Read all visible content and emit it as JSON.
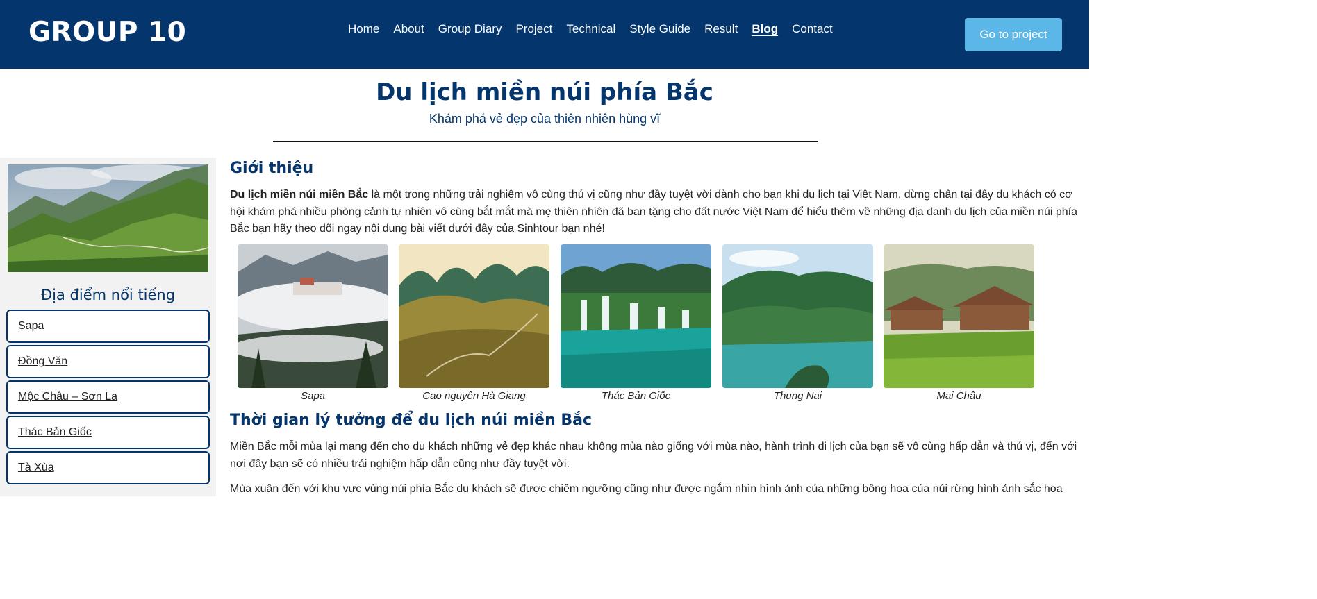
{
  "header": {
    "logo": "GROUP 10",
    "nav": [
      "Home",
      "About",
      "Group Diary",
      "Project",
      "Technical",
      "Style Guide",
      "Result",
      "Blog",
      "Contact"
    ],
    "active_nav": "Blog",
    "cta_label": "Go to project"
  },
  "page": {
    "title": "Du lịch miền núi phía Bắc",
    "subtitle": "Khám phá vẻ đẹp của thiên nhiên hùng vĩ"
  },
  "sidebar": {
    "heading": "Địa điểm nổi tiếng",
    "items": [
      "Sapa",
      "Đồng Văn",
      "Mộc Châu – Sơn La",
      "Thác Bản Giốc",
      "Tà Xùa"
    ]
  },
  "intro": {
    "heading": "Giới thiệu",
    "bold_lead": "Du lịch miền núi miền Bắc",
    "body": " là một trong những trải nghiệm vô cùng thú vị cũng như đầy tuyệt vời dành cho bạn khi du lịch tại Việt Nam, dừng chân tại đây du khách có cơ hội khám phá nhiều phòng cảnh tự nhiên vô cùng bắt mắt mà mẹ thiên nhiên đã ban tặng cho đất nước Việt Nam để hiểu thêm về những địa danh du lịch của miền núi phía Bắc bạn hãy theo dõi ngay nội dung bài viết dưới đây của Sinhtour bạn nhé!"
  },
  "gallery": {
    "captions": [
      "Sapa",
      "Cao nguyên Hà Giang",
      "Thác Bản Giốc",
      "Thung Nai",
      "Mai Châu"
    ]
  },
  "time_section": {
    "heading": "Thời gian lý tưởng để du lịch núi miền Bắc",
    "para1": "Miền Bắc mỗi mùa lại mang đến cho du khách những vẻ đẹp khác nhau không mùa nào giống với mùa nào, hành trình di lịch của bạn sẽ vô cùng hấp dẫn và thú vị, đến với nơi đây bạn sẽ có nhiều trải nghiệm hấp dẫn cũng như đầy tuyệt vời.",
    "para2": "Mùa xuân đến với khu vực vùng núi phía Bắc du khách sẽ được chiêm ngưỡng cũng như được ngắm nhìn hình ảnh của những bông hoa của núi rừng hình ảnh sắc hoa"
  },
  "colors": {
    "primary": "#04356c",
    "accent": "#5bb7e8",
    "sidebar_bg": "#f2f2f2"
  }
}
